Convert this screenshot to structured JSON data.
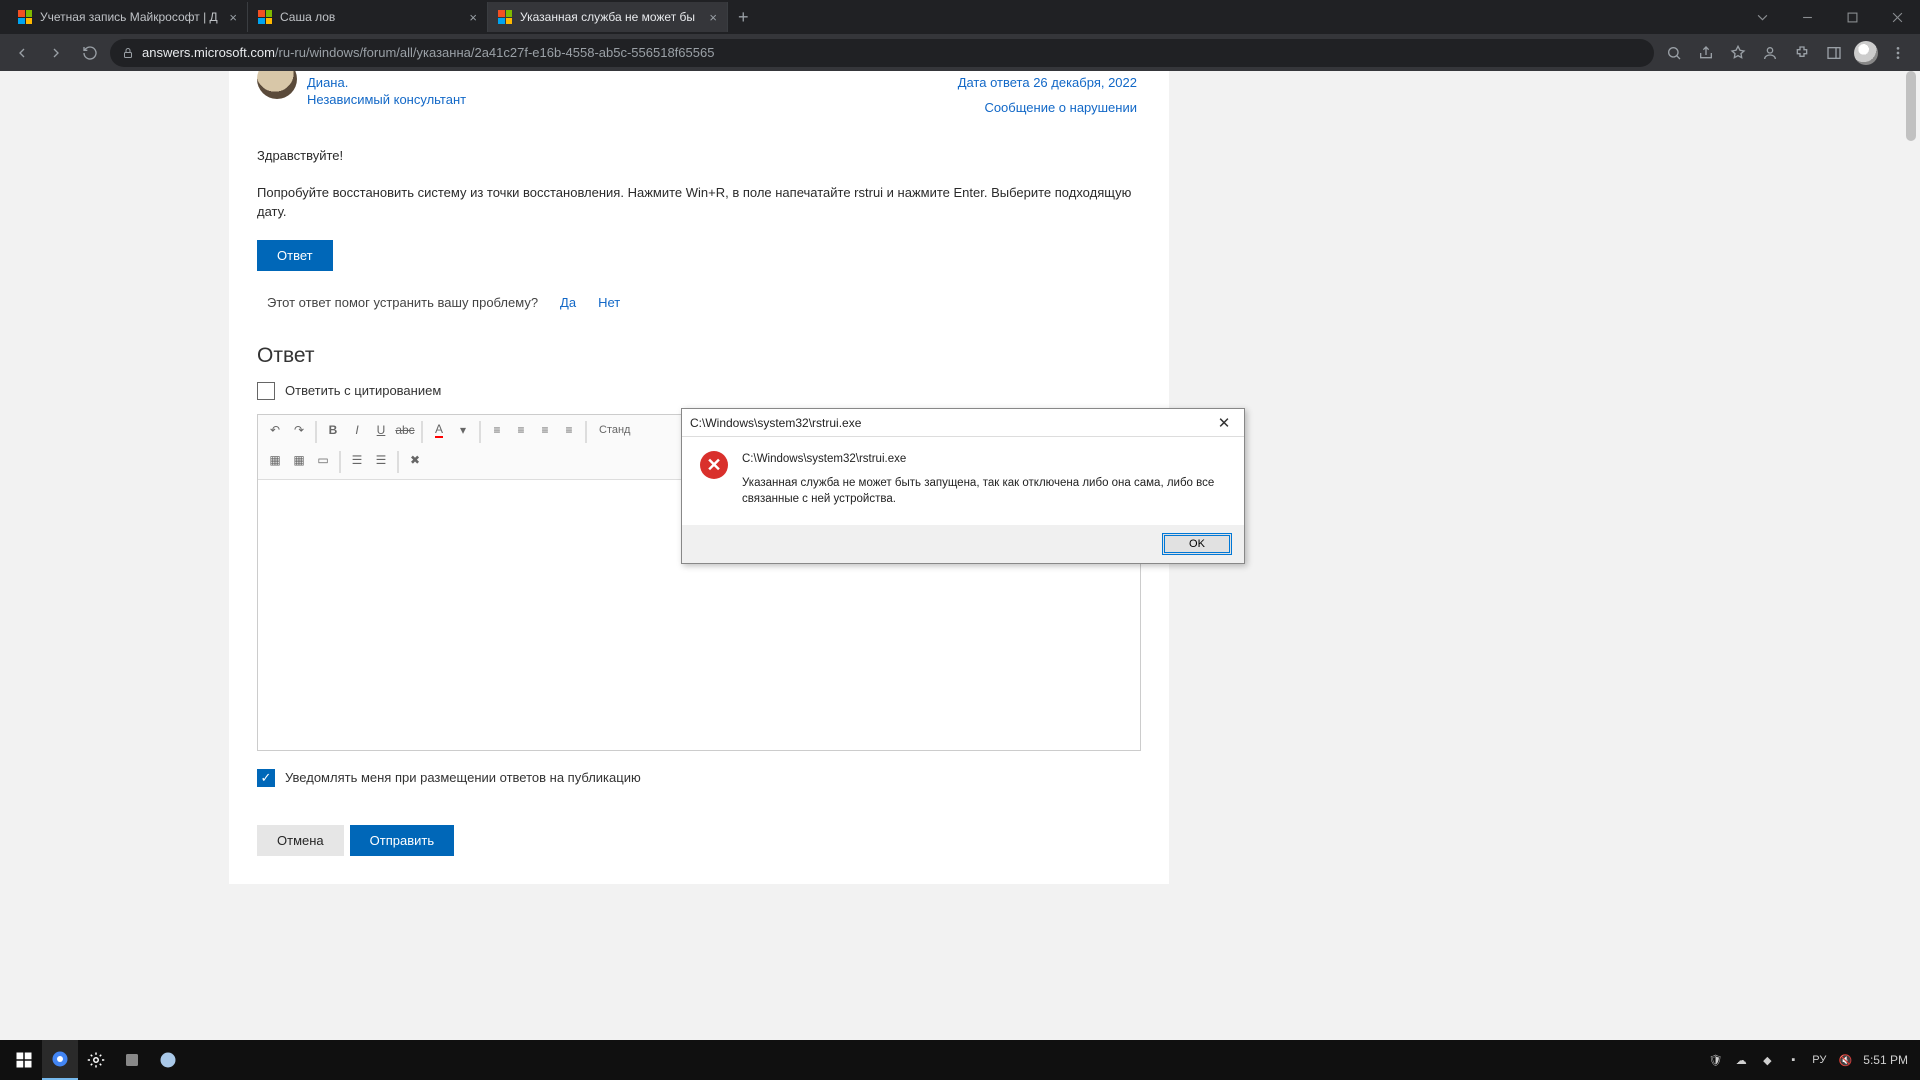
{
  "browser": {
    "tabs": [
      {
        "title": "Учетная запись Майкрософт | Д",
        "active": false
      },
      {
        "title": "Саша лов",
        "active": false
      },
      {
        "title": "Указанная служба не может бы",
        "active": true
      }
    ],
    "url_host": "answers.microsoft.com",
    "url_path": "/ru-ru/windows/forum/all/указанна/2a41c27f-e16b-4558-ab5c-556518f65565"
  },
  "answer": {
    "author_name": "Диана.",
    "author_role": "Независимый консультант",
    "date_label": "Дата ответа 26 декабря, 2022",
    "report_label": "Сообщение о нарушении",
    "greeting": "Здравствуйте!",
    "body": "Попробуйте восстановить систему из точки восстановления. Нажмите Win+R, в поле напечатайте rstrui и нажмите Enter. Выберите подходящую дату.",
    "reply_btn": "Ответ",
    "helpful_q": "Этот ответ помог устранить вашу проблему?",
    "yes": "Да",
    "no": "Нет"
  },
  "reply": {
    "heading": "Ответ",
    "quote_label": "Ответить с цитированием",
    "font_dropdown": "Станд",
    "notify_label": "Уведомлять меня при размещении ответов на публикацию",
    "cancel_btn": "Отмена",
    "submit_btn": "Отправить"
  },
  "error_dialog": {
    "title": "C:\\Windows\\system32\\rstrui.exe",
    "path": "C:\\Windows\\system32\\rstrui.exe",
    "message": "Указанная служба не может быть запущена, так как отключена либо она сама, либо все связанные с ней устройства.",
    "ok": "OK"
  },
  "taskbar": {
    "time": "5:51 PM"
  }
}
